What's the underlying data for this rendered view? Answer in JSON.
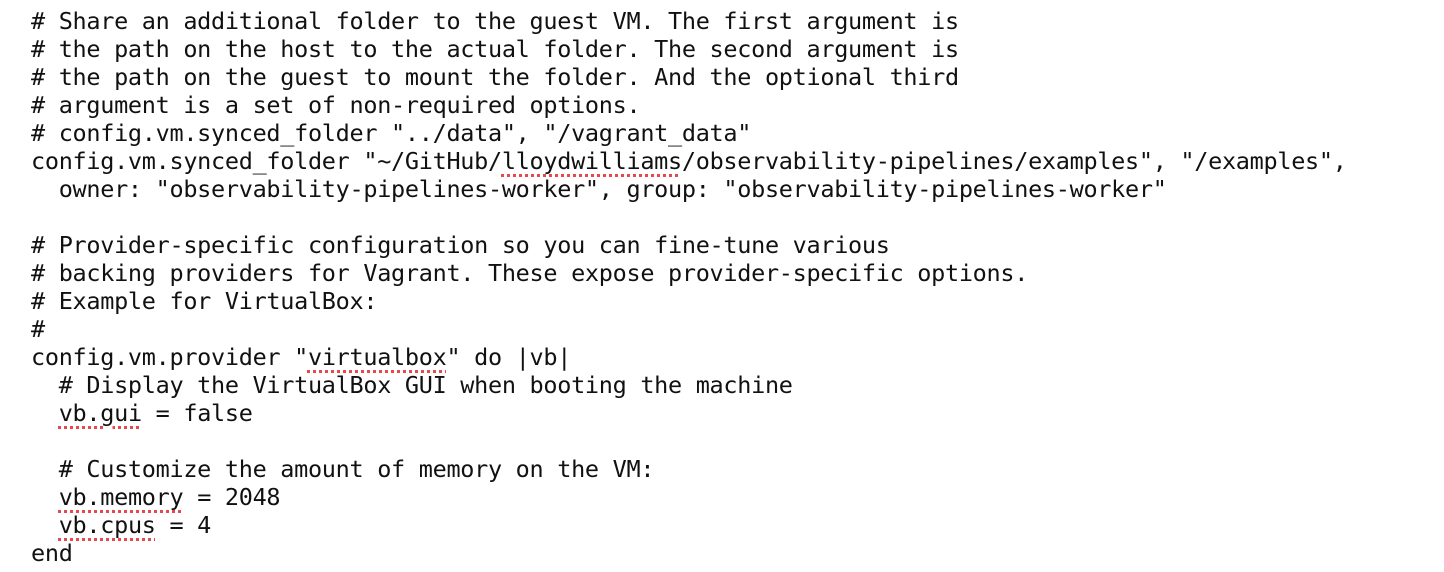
{
  "editor": {
    "spellcheck_color": "#e5484d",
    "text_color": "#111111",
    "background_color": "#ffffff",
    "lines": [
      [
        {
          "t": "# Share an additional folder to the guest VM. The first argument is"
        }
      ],
      [
        {
          "t": "# the path on the host to the actual folder. The second argument is"
        }
      ],
      [
        {
          "t": "# the path on the guest to mount the folder. And the optional third"
        }
      ],
      [
        {
          "t": "# argument is a set of non-required options."
        }
      ],
      [
        {
          "t": "# config.vm.synced_folder \"../data\", \"/vagrant_data\""
        }
      ],
      [
        {
          "t": "config.vm.synced_folder \"~/GitHub/"
        },
        {
          "t": "lloydwilliams",
          "spell": true
        },
        {
          "t": "/observability-pipelines/examples\", \"/examples\","
        }
      ],
      [
        {
          "t": "  owner: \"observability-pipelines-worker\", group: \"observability-pipelines-worker\""
        }
      ],
      [
        {
          "t": ""
        }
      ],
      [
        {
          "t": "# Provider-specific configuration so you can fine-tune various"
        }
      ],
      [
        {
          "t": "# backing providers for Vagrant. These expose provider-specific options."
        }
      ],
      [
        {
          "t": "# Example for VirtualBox:"
        }
      ],
      [
        {
          "t": "#"
        }
      ],
      [
        {
          "t": "config.vm.provider \""
        },
        {
          "t": "virtualbox",
          "spell": true
        },
        {
          "t": "\" do |vb|"
        }
      ],
      [
        {
          "t": "  # Display the VirtualBox GUI when booting the machine"
        }
      ],
      [
        {
          "t": "  "
        },
        {
          "t": "vb.gui",
          "spell": true
        },
        {
          "t": " = false"
        }
      ],
      [
        {
          "t": ""
        }
      ],
      [
        {
          "t": "  # Customize the amount of memory on the VM:"
        }
      ],
      [
        {
          "t": "  "
        },
        {
          "t": "vb.memory",
          "spell": true
        },
        {
          "t": " = 2048"
        }
      ],
      [
        {
          "t": "  "
        },
        {
          "t": "vb.cpus",
          "spell": true
        },
        {
          "t": " = 4"
        }
      ],
      [
        {
          "t": "end"
        }
      ]
    ]
  }
}
